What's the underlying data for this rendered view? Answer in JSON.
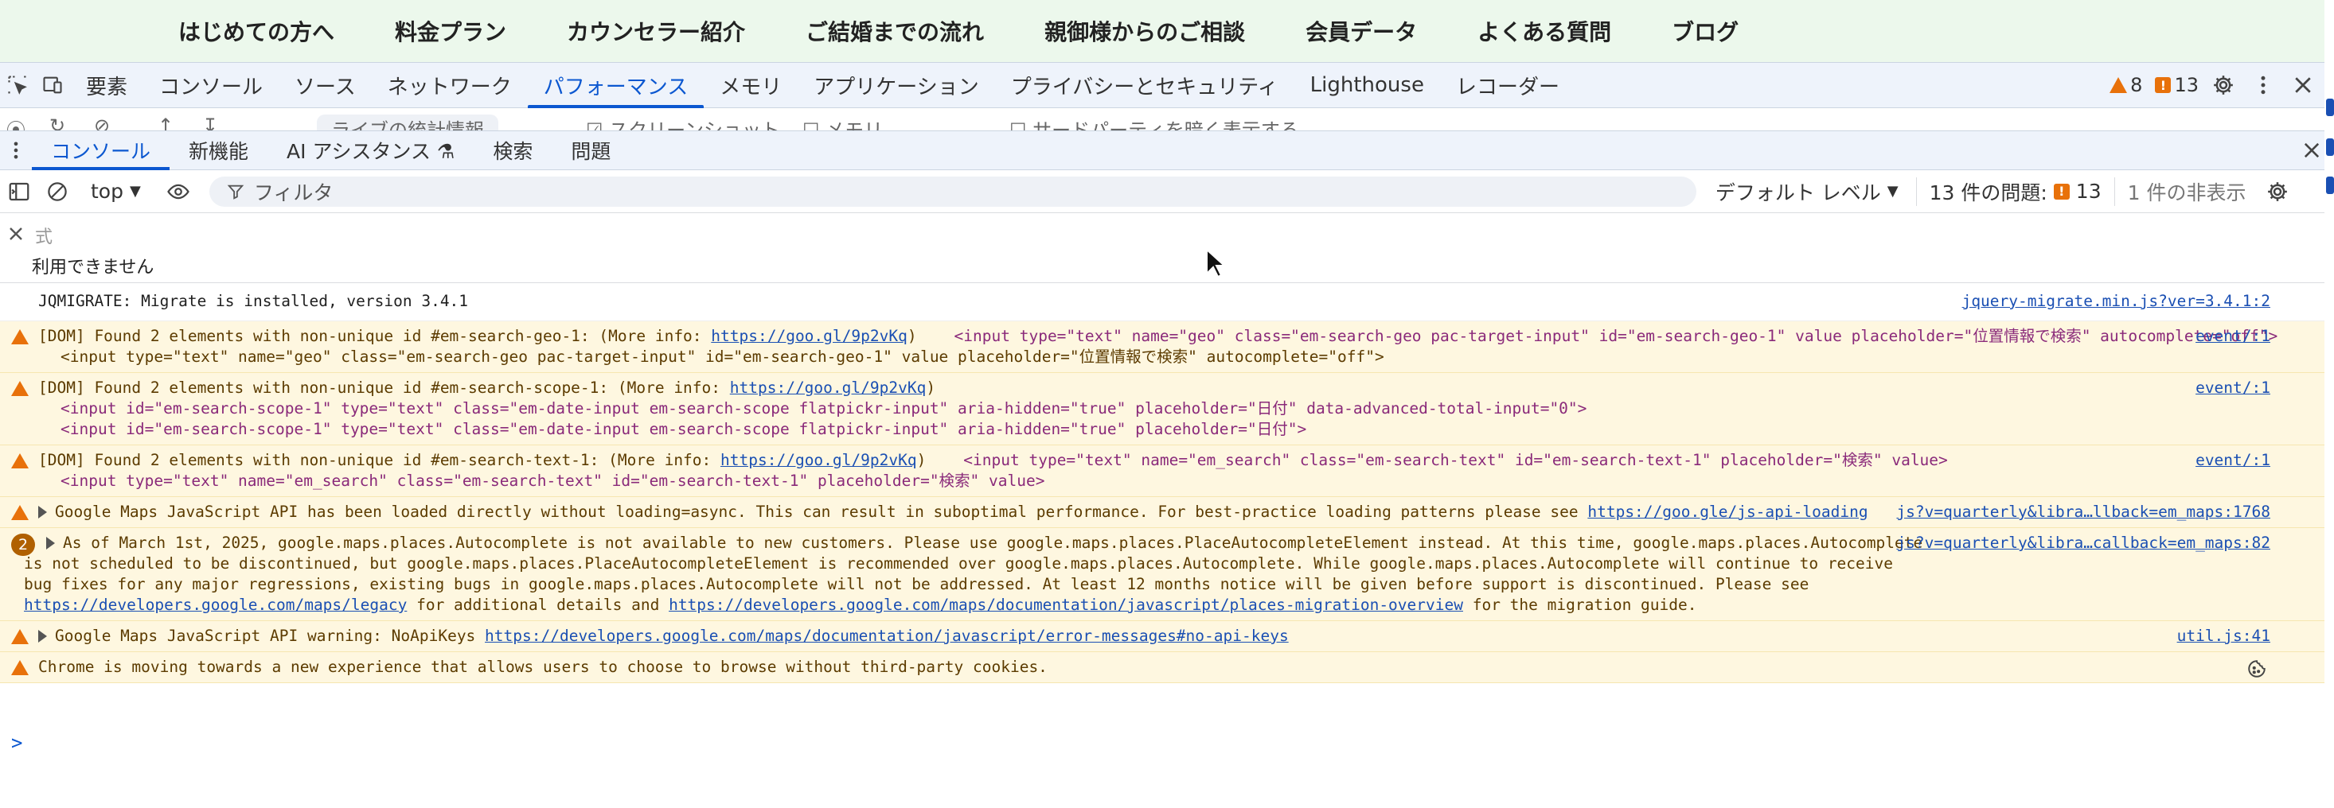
{
  "site_nav": {
    "items": [
      "はじめての方へ",
      "料金プラン",
      "カウンセラー紹介",
      "ご結婚までの流れ",
      "親御様からのご相談",
      "会員データ",
      "よくある質問",
      "ブログ"
    ]
  },
  "devtools": {
    "main_tabs": [
      "要素",
      "コンソール",
      "ソース",
      "ネットワーク",
      "パフォーマンス",
      "メモリ",
      "アプリケーション",
      "プライバシーとセキュリティ",
      "Lighthouse",
      "レコーダー"
    ],
    "active_main_tab": "パフォーマンス",
    "warning_count": "8",
    "issue_count": "13",
    "perf_strip": {
      "placeholder": "ライブの統計情報",
      "screenshot_label": "スクリーンショット",
      "memory_label": "メモリ",
      "third_party_label": "サードパーティを暗く表示する"
    },
    "drawer_tabs": [
      "コンソール",
      "新機能",
      "AI アシスタンス ⚗",
      "検索",
      "問題"
    ],
    "active_drawer_tab": "コンソール",
    "console_toolbar": {
      "context": "top",
      "filter_placeholder": "フィルタ",
      "level": "デフォルト レベル",
      "issues_label": "13 件の問題:",
      "issues_count": "13",
      "hidden_label": "1 件の非表示"
    },
    "live_expression": {
      "placeholder": "式",
      "result": "利用できません"
    }
  },
  "messages": {
    "m1": {
      "text": "JQMIGRATE: Migrate is installed, version 3.4.1",
      "source": "jquery-migrate.min.js?ver=3.4.1:2"
    },
    "m2": {
      "prefix": "[DOM] Found 2 elements with non-unique id #em-search-geo-1: (More info: ",
      "link": "https://goo.gl/9p2vKq",
      "suffix": ")",
      "line1_code": "<input type=\"text\" name=\"geo\" class=\"em-search-geo pac-target-input\" id=\"em-search-geo-1\" value placeholder=\"位置情報で検索\" autocomplete=\"off\">",
      "line2_code": "<input type=\"text\" name=\"geo\" class=\"em-search-geo pac-target-input\" id=\"em-search-geo-1\" value placeholder=\"位置情報で検索\" autocomplete=\"off\">",
      "source": "event/:1"
    },
    "m3": {
      "prefix": "[DOM] Found 2 elements with non-unique id #em-search-scope-1: (More info: ",
      "link": "https://goo.gl/9p2vKq",
      "suffix": ")",
      "line1_code": "<input id=\"em-search-scope-1\" type=\"text\" class=\"em-date-input em-search-scope flatpickr-input\" aria-hidden=\"true\" placeholder=\"日付\" data-advanced-total-input=\"0\">",
      "line2_code": "<input id=\"em-search-scope-1\" type=\"text\" class=\"em-date-input em-search-scope flatpickr-input\" aria-hidden=\"true\" placeholder=\"日付\">",
      "source": "event/:1"
    },
    "m4": {
      "prefix": "[DOM] Found 2 elements with non-unique id #em-search-text-1: (More info: ",
      "link": "https://goo.gl/9p2vKq",
      "suffix": ")",
      "line1_code": "<input type=\"text\" name=\"em_search\" class=\"em-search-text\" id=\"em-search-text-1\" placeholder=\"検索\" value>",
      "line2_code": "<input type=\"text\" name=\"em_search\" class=\"em-search-text\" id=\"em-search-text-1\" placeholder=\"検索\" value>",
      "source": "event/:1"
    },
    "m5": {
      "text": "Google Maps JavaScript API has been loaded directly without loading=async. This can result in suboptimal performance. For best-practice loading patterns please see ",
      "link": "https://goo.gle/js-api-loading",
      "source": "js?v=quarterly&libra…llback=em_maps:1768"
    },
    "m6": {
      "count": "2",
      "text": "As of March 1st, 2025, google.maps.places.Autocomplete is not available to new customers. Please use google.maps.places.PlaceAutocompleteElement instead. At this time, google.maps.places.Autocomplete is not scheduled to be discontinued, but google.maps.places.PlaceAutocompleteElement is recommended over google.maps.places.Autocomplete. While google.maps.places.Autocomplete will continue to receive bug fixes for any major regressions, existing bugs in google.maps.places.Autocomplete will not be addressed. At least 12 months notice will be given before support is discontinued. Please see ",
      "link1": "https://developers.google.com/maps/legacy",
      "mid": " for additional details and ",
      "link2": "https://developers.google.com/maps/documentation/javascript/places-migration-overview",
      "tail": " for the migration guide.",
      "source": "js?v=quarterly&libra…callback=em_maps:82"
    },
    "m7": {
      "text": "Google Maps JavaScript API warning: NoApiKeys ",
      "link": "https://developers.google.com/maps/documentation/javascript/error-messages#no-api-keys",
      "source": "util.js:41"
    },
    "m8": {
      "text": "Chrome is moving towards a new experience that allows users to choose to browse without third-party cookies."
    }
  },
  "prompt_symbol": ">",
  "colors": {
    "accent": "#0b57d0",
    "warning_bg": "#fef7e0",
    "warning_icon": "#e8710a",
    "site_nav_bg": "#ecf8ec"
  }
}
